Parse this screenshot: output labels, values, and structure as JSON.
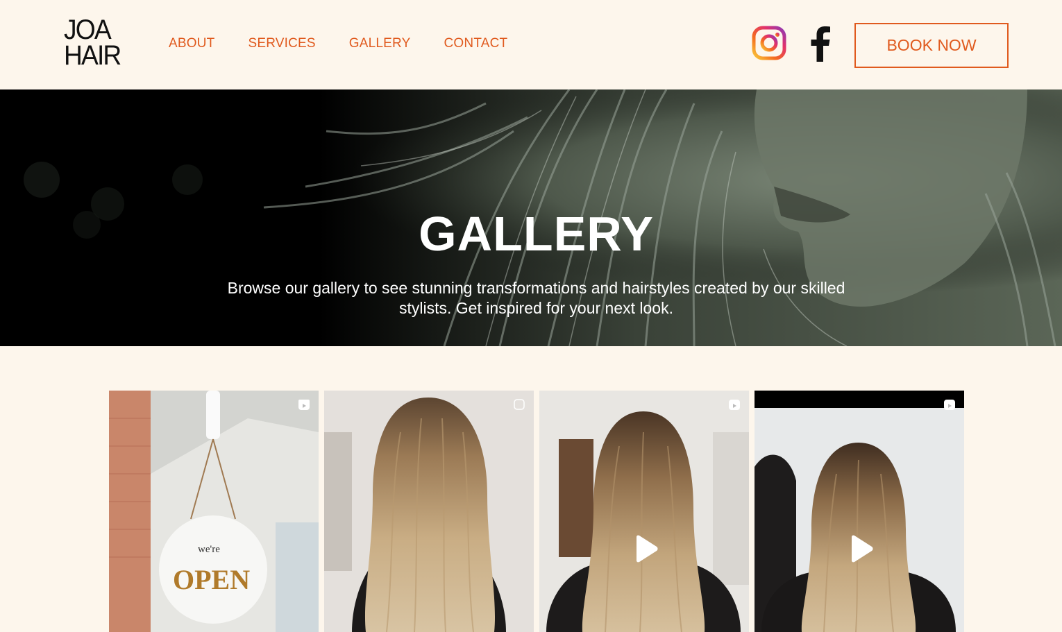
{
  "brand": {
    "line1": "JOA",
    "line2": "HAIR"
  },
  "nav": {
    "items": [
      {
        "label": "ABOUT"
      },
      {
        "label": "SERVICES"
      },
      {
        "label": "GALLERY"
      },
      {
        "label": "CONTACT"
      }
    ]
  },
  "social": {
    "instagram_icon": "instagram-icon",
    "facebook_icon": "facebook-icon"
  },
  "cta": {
    "book_label": "BOOK NOW"
  },
  "hero": {
    "title": "GALLERY",
    "subtitle_line1": "Browse our gallery to see stunning transformations and hairstyles created by our skilled",
    "subtitle_line2": "stylists. Get inspired for your next look."
  },
  "gallery": {
    "tiles": [
      {
        "sign_small": "we're",
        "sign_big": "OPEN",
        "icon": "reel-icon",
        "has_play": false
      },
      {
        "icon": "reel-icon",
        "has_play": false
      },
      {
        "icon": "reel-icon",
        "has_play": true
      },
      {
        "icon": "reel-icon",
        "has_play": true
      }
    ]
  },
  "colors": {
    "accent": "#e05a1e",
    "background": "#fdf6ec",
    "text_dark": "#111111"
  }
}
